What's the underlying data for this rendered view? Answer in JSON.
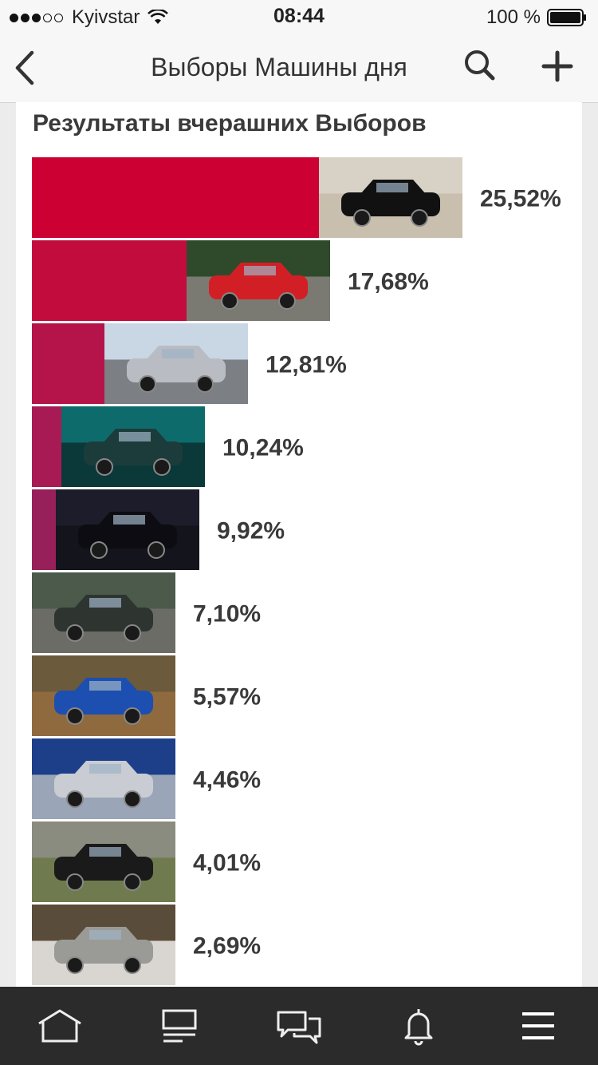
{
  "status_bar": {
    "carrier": "Kyivstar",
    "time": "08:44",
    "battery": "100 %"
  },
  "nav": {
    "title": "Выборы Машины дня"
  },
  "chart_data": {
    "type": "bar",
    "orientation": "horizontal",
    "title": "Результаты вчерашних Выборов",
    "xlim": [
      0,
      25.52
    ],
    "categories": [
      "",
      "",
      "",
      "",
      "",
      "",
      "",
      "",
      "",
      ""
    ],
    "values": [
      25.52,
      17.68,
      12.81,
      10.24,
      9.92,
      7.1,
      5.57,
      4.46,
      4.01,
      2.69
    ],
    "labels": [
      "25,52%",
      "17,68%",
      "12,81%",
      "10,24%",
      "9,92%",
      "7,10%",
      "5,57%",
      "4,46%",
      "4,01%",
      "2,69%"
    ],
    "colors": [
      "#cc0033",
      "#c30c3e",
      "#b5144b",
      "#a81a54",
      "#98205a",
      "#7d2a62",
      "#602e6e",
      "#47377a",
      "#343f85",
      "#26498f"
    ],
    "thumbnails": [
      "black-sedan-photo",
      "red-mini-photo",
      "silver-coupe-photo",
      "teal-bmw-photo",
      "black-bmw-photo",
      "suv-photo",
      "blue-ford-photo",
      "silver-suv-photo",
      "dark-sedan-photo",
      "gray-skoda-photo"
    ]
  },
  "tabs": [
    {
      "icon": "home-icon"
    },
    {
      "icon": "feed-icon"
    },
    {
      "icon": "messages-icon"
    },
    {
      "icon": "bell-icon"
    },
    {
      "icon": "menu-icon"
    }
  ]
}
